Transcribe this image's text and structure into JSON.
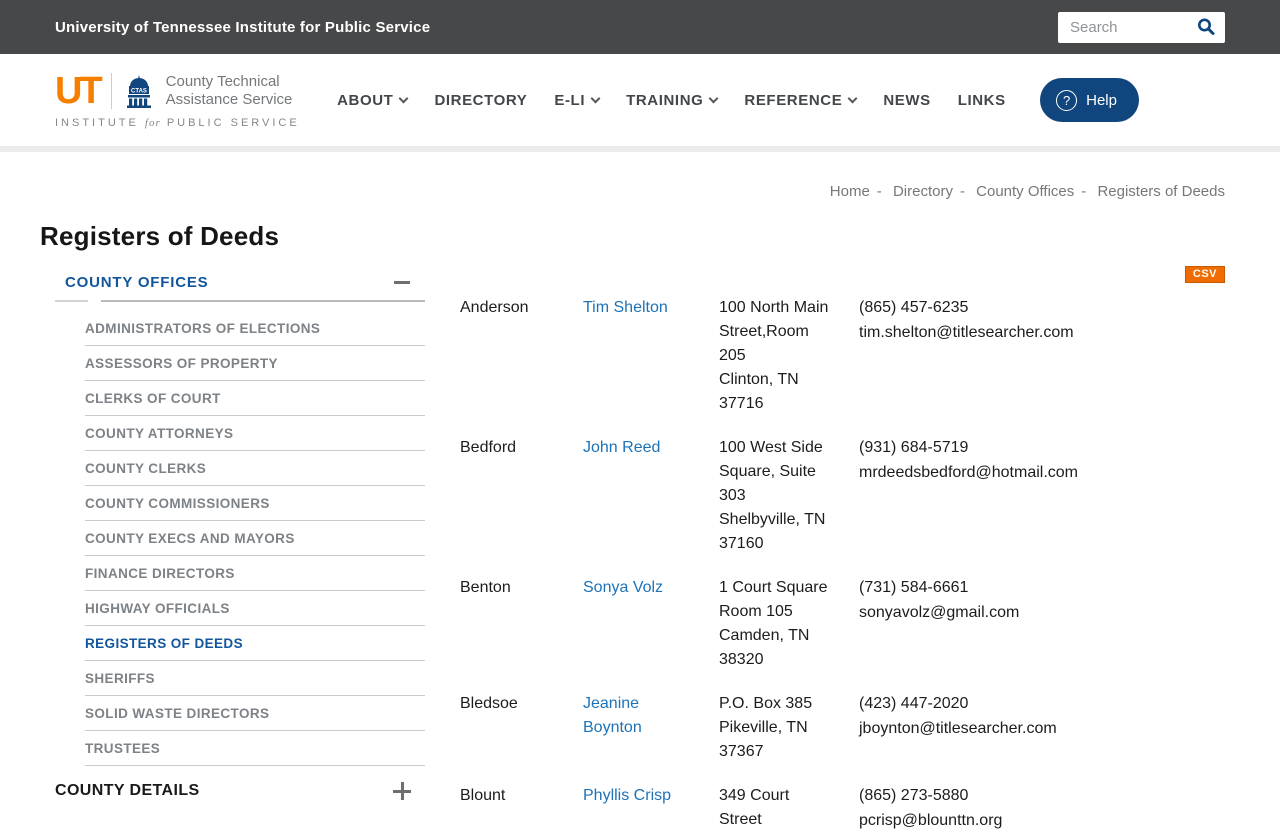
{
  "colors": {
    "topbar-bg": "#47484a",
    "brand-blue": "#11457e",
    "heading-blue": "#11569c",
    "link-blue": "#1d72b8",
    "ut-orange": "#f77f00",
    "csv-orange": "#f06c00",
    "text-gray": "#75787b",
    "nav-text": "#43464a",
    "sidebar-item": "#7d8287"
  },
  "topbar": {
    "title": "University of Tennessee Institute for Public Service",
    "search_placeholder": "Search"
  },
  "logo": {
    "ut_mark": "UT",
    "ctas": "CTAS",
    "org_line1": "County Technical",
    "org_line2": "Assistance Service",
    "institute_pre": "INSTITUTE",
    "institute_for": "for",
    "institute_post": "PUBLIC SERVICE"
  },
  "nav": {
    "items": [
      {
        "label": "ABOUT",
        "dropdown": true
      },
      {
        "label": "DIRECTORY"
      },
      {
        "label": "E-LI",
        "dropdown": true
      },
      {
        "label": "TRAINING",
        "dropdown": true
      },
      {
        "label": "REFERENCE",
        "dropdown": true
      },
      {
        "label": "NEWS"
      },
      {
        "label": "LINKS"
      }
    ],
    "help_label": "Help"
  },
  "breadcrumb": {
    "separator": "-",
    "items": [
      {
        "label": "Home"
      },
      {
        "label": "Directory"
      },
      {
        "label": "County Offices"
      },
      {
        "label": "Registers of Deeds"
      }
    ]
  },
  "page": {
    "title": "Registers of Deeds"
  },
  "sidebar": {
    "section_title": "COUNTY OFFICES",
    "items": [
      {
        "label": "ADMINISTRATORS OF ELECTIONS"
      },
      {
        "label": "ASSESSORS OF PROPERTY"
      },
      {
        "label": "CLERKS OF COURT"
      },
      {
        "label": "COUNTY ATTORNEYS"
      },
      {
        "label": "COUNTY CLERKS"
      },
      {
        "label": "COUNTY COMMISSIONERS"
      },
      {
        "label": "COUNTY EXECS AND MAYORS"
      },
      {
        "label": "FINANCE DIRECTORS"
      },
      {
        "label": "HIGHWAY OFFICIALS"
      },
      {
        "label": "REGISTERS OF DEEDS",
        "active": true
      },
      {
        "label": "SHERIFFS"
      },
      {
        "label": "SOLID WASTE DIRECTORS"
      },
      {
        "label": "TRUSTEES"
      }
    ],
    "footer_title": "COUNTY DETAILS"
  },
  "table": {
    "csv_label": "CSV",
    "rows": [
      {
        "county": "Anderson",
        "name": "Tim Shelton",
        "address_lines": [
          "100 North Main Street,Room 205",
          "Clinton, TN 37716"
        ],
        "phone": "(865) 457-6235",
        "email": "tim.shelton@titlesearcher.com"
      },
      {
        "county": "Bedford",
        "name": "John Reed",
        "address_lines": [
          "100 West Side Square, Suite 303",
          "Shelbyville, TN 37160"
        ],
        "phone": "(931) 684-5719",
        "email": "mrdeedsbedford@hotmail.com"
      },
      {
        "county": "Benton",
        "name": "Sonya Volz",
        "address_lines": [
          "1 Court Square Room 105",
          "Camden, TN 38320"
        ],
        "phone": "(731) 584-6661",
        "email": "sonyavolz@gmail.com"
      },
      {
        "county": "Bledsoe",
        "name": "Jeanine Boynton",
        "address_lines": [
          "P.O. Box 385",
          "Pikeville, TN 37367"
        ],
        "phone": "(423) 447-2020",
        "email": "jboynton@titlesearcher.com"
      },
      {
        "county": "Blount",
        "name": "Phyllis Crisp",
        "address_lines": [
          "349 Court Street"
        ],
        "phone": "(865) 273-5880",
        "email": "pcrisp@blounttn.org"
      }
    ]
  }
}
